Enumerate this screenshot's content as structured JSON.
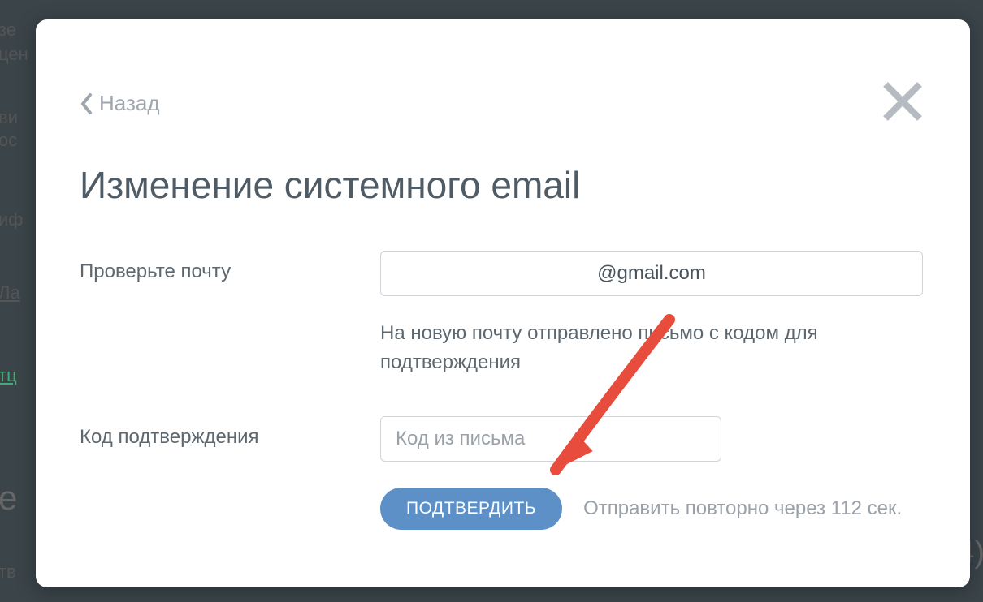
{
  "dialog": {
    "back_label": "Назад",
    "title": "Изменение системного email",
    "email_label": "Проверьте почту",
    "email_value": "@gmail.com",
    "helper_text": "На новую почту отправлено письмо с кодом для подтверждения",
    "code_label": "Код подтверждения",
    "code_placeholder": "Код из письма",
    "confirm_label": "ПОДТВЕРДИТЬ",
    "resend_text": "Отправить повторно через 112 сек."
  }
}
